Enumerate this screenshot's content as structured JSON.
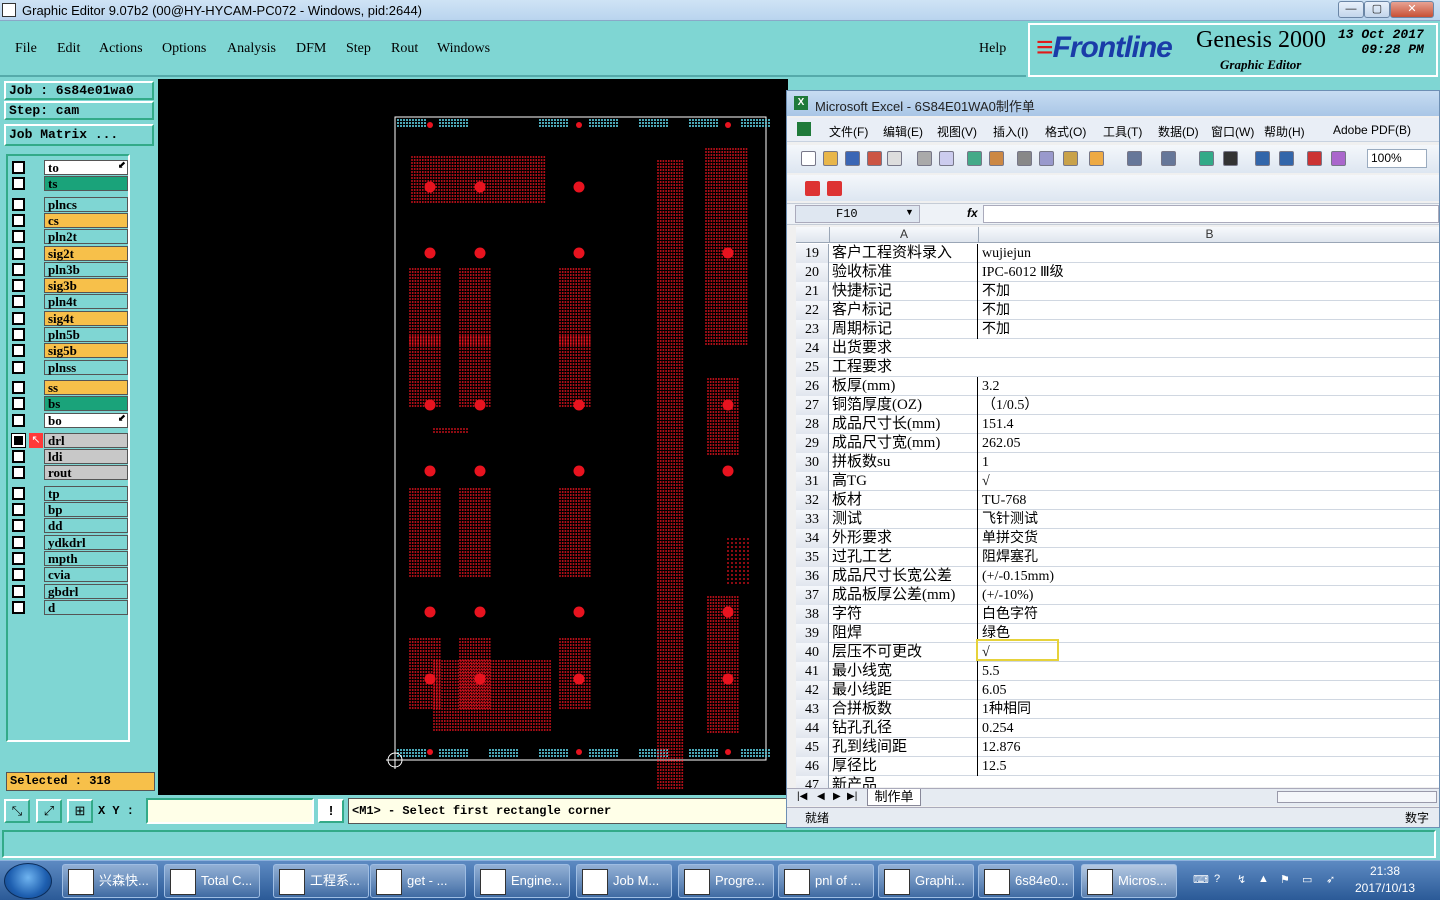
{
  "window": {
    "title": "Graphic Editor 9.07b2 (00@HY-HYCAM-PC072 - Windows, pid:2644)"
  },
  "menu": {
    "items": [
      "File",
      "Edit",
      "Actions",
      "Options",
      "Analysis",
      "DFM",
      "Step",
      "Rout",
      "Windows"
    ],
    "help": "Help"
  },
  "logo": {
    "brand": "Frontline",
    "product": "Genesis 2000",
    "subtitle": "Graphic Editor",
    "date": "13 Oct 2017",
    "time": "09:28 PM"
  },
  "job": {
    "job_line": "Job : 6s84e01wa0",
    "step_line": "Step: cam",
    "matrix_button": "Job Matrix ..."
  },
  "layers": [
    {
      "name": "to",
      "color": "#ffffff",
      "state": "off",
      "arrow": true
    },
    {
      "name": "ts",
      "color": "#1aa37a",
      "state": "off"
    },
    {
      "name": "plncs",
      "color": "#7fd6d3",
      "state": "off"
    },
    {
      "name": "cs",
      "color": "#f7c04a",
      "state": "off"
    },
    {
      "name": "pln2t",
      "color": "#7fd6d3",
      "state": "off"
    },
    {
      "name": "sig2t",
      "color": "#f7c04a",
      "state": "off"
    },
    {
      "name": "pln3b",
      "color": "#7fd6d3",
      "state": "off"
    },
    {
      "name": "sig3b",
      "color": "#f7c04a",
      "state": "off"
    },
    {
      "name": "pln4t",
      "color": "#7fd6d3",
      "state": "off"
    },
    {
      "name": "sig4t",
      "color": "#f7c04a",
      "state": "off"
    },
    {
      "name": "pln5b",
      "color": "#7fd6d3",
      "state": "off"
    },
    {
      "name": "sig5b",
      "color": "#f7c04a",
      "state": "off"
    },
    {
      "name": "plnss",
      "color": "#7fd6d3",
      "state": "off"
    },
    {
      "name": "ss",
      "color": "#f7c04a",
      "state": "off"
    },
    {
      "name": "bs",
      "color": "#1aa37a",
      "state": "off"
    },
    {
      "name": "bo",
      "color": "#ffffff",
      "state": "off",
      "arrow": true
    },
    {
      "name": "drl",
      "color": "#c8c8c8",
      "state": "on",
      "work": true
    },
    {
      "name": "ldi",
      "color": "#c8c8c8",
      "state": "off"
    },
    {
      "name": "rout",
      "color": "#c8c8c8",
      "state": "off"
    },
    {
      "name": "tp",
      "color": "#7fd6d3",
      "state": "off"
    },
    {
      "name": "bp",
      "color": "#7fd6d3",
      "state": "off"
    },
    {
      "name": "dd",
      "color": "#7fd6d3",
      "state": "off"
    },
    {
      "name": "ydkdrl",
      "color": "#7fd6d3",
      "state": "off"
    },
    {
      "name": "mpth",
      "color": "#7fd6d3",
      "state": "off"
    },
    {
      "name": "cvia",
      "color": "#7fd6d3",
      "state": "off"
    },
    {
      "name": "gbdrl",
      "color": "#7fd6d3",
      "state": "off"
    },
    {
      "name": "d",
      "color": "#7fd6d3",
      "state": "off"
    }
  ],
  "selected": "Selected : 318",
  "bottom": {
    "xy_label": "X Y :",
    "xy_value": "",
    "message": "<M1> - Select first rectangle corner"
  },
  "excel": {
    "title": "Microsoft Excel - 6S84E01WA0制作单",
    "menu": [
      "文件(F)",
      "编辑(E)",
      "视图(V)",
      "插入(I)",
      "格式(O)",
      "工具(T)",
      "数据(D)",
      "窗口(W)",
      "帮助(H)",
      "Adobe PDF(B)"
    ],
    "zoom": "100%",
    "name_box": "F10",
    "fx": "fx",
    "columns": [
      "A",
      "B"
    ],
    "rows": [
      {
        "n": "19",
        "a": "客户工程资料录入",
        "b": "wujiejun"
      },
      {
        "n": "20",
        "a": "验收标准",
        "b": "IPC-6012 Ⅲ级"
      },
      {
        "n": "21",
        "a": "快捷标记",
        "b": "不加"
      },
      {
        "n": "22",
        "a": "客户标记",
        "b": "不加"
      },
      {
        "n": "23",
        "a": "周期标记",
        "b": "不加"
      },
      {
        "n": "24",
        "a": "出货要求",
        "b": ""
      },
      {
        "n": "25",
        "a": "工程要求",
        "b": ""
      },
      {
        "n": "26",
        "a": "板厚(mm)",
        "b": "3.2"
      },
      {
        "n": "27",
        "a": "铜箔厚度(OZ)",
        "b": "（1/0.5）"
      },
      {
        "n": "28",
        "a": "成品尺寸长(mm)",
        "b": "151.4"
      },
      {
        "n": "29",
        "a": "成品尺寸宽(mm)",
        "b": "262.05"
      },
      {
        "n": "30",
        "a": "拼板数su",
        "b": "1"
      },
      {
        "n": "31",
        "a": "高TG",
        "b": "√"
      },
      {
        "n": "32",
        "a": "板材",
        "b": "TU-768"
      },
      {
        "n": "33",
        "a": "测试",
        "b": "飞针测试"
      },
      {
        "n": "34",
        "a": "外形要求",
        "b": "单拼交货"
      },
      {
        "n": "35",
        "a": "过孔工艺",
        "b": "阻焊塞孔"
      },
      {
        "n": "36",
        "a": "成品尺寸长宽公差",
        "b": "(+/-0.15mm)"
      },
      {
        "n": "37",
        "a": "成品板厚公差(mm)",
        "b": "(+/-10%)"
      },
      {
        "n": "38",
        "a": "字符",
        "b": "白色字符"
      },
      {
        "n": "39",
        "a": "阻焊",
        "b": "绿色"
      },
      {
        "n": "40",
        "a": "层压不可更改",
        "b": "√"
      },
      {
        "n": "41",
        "a": "最小线宽",
        "b": "5.5"
      },
      {
        "n": "42",
        "a": "最小线距",
        "b": "6.05"
      },
      {
        "n": "43",
        "a": "合拼板数",
        "b": "1种相同"
      },
      {
        "n": "44",
        "a": "钻孔孔径",
        "b": "0.254"
      },
      {
        "n": "45",
        "a": "孔到线间距",
        "b": "12.876"
      },
      {
        "n": "46",
        "a": "厚径比",
        "b": "12.5"
      },
      {
        "n": "47",
        "a": "新产品",
        "b": ""
      }
    ],
    "sheet_tab": "制作单",
    "status_left": "就绪",
    "status_right": "数字"
  },
  "taskbar": {
    "tasks": [
      "兴森快...",
      "Total C...",
      "工程系...",
      "get - ...",
      "Engine...",
      "Job M...",
      "Progre...",
      "pnl of ...",
      "Graphi...",
      "6s84e0...",
      "Micros..."
    ],
    "time": "21:38",
    "date": "2017/10/13"
  }
}
